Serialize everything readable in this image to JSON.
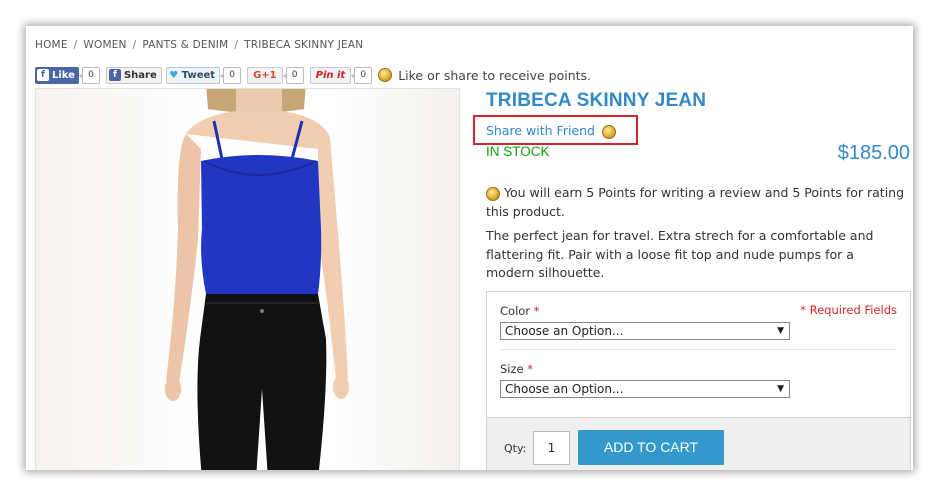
{
  "breadcrumb": {
    "items": [
      "HOME",
      "WOMEN",
      "PANTS & DENIM",
      "TRIBECA SKINNY JEAN"
    ],
    "separator": "/"
  },
  "social": {
    "fb_like": {
      "icon": "facebook-icon",
      "label": "Like",
      "count": "0"
    },
    "fb_share": {
      "icon": "facebook-icon",
      "label": "Share"
    },
    "tweet": {
      "icon": "twitter-bird-icon",
      "label": "Tweet",
      "count": "0"
    },
    "gplus": {
      "label": "G+1",
      "count": "0"
    },
    "pinit": {
      "label": "Pin it",
      "count": "0"
    },
    "reward_icon": "points-coin-icon",
    "reward_text": "Like or share to receive points."
  },
  "product": {
    "title": "TRIBECA SKINNY JEAN",
    "share_friend": "Share with Friend",
    "stock": "IN STOCK",
    "price": "$185.00",
    "points_note": "You will earn 5 Points for writing a review and 5 Points for rating this product.",
    "description": "The perfect jean for travel. Extra strech for a comfortable and flattering fit. Pair with a loose fit top and nude pumps for a modern silhouette."
  },
  "options": {
    "required_note": "* Required Fields",
    "color": {
      "label": "Color",
      "required_mark": "*",
      "selected": "Choose an Option..."
    },
    "size": {
      "label": "Size",
      "required_mark": "*",
      "selected": "Choose an Option..."
    }
  },
  "cart": {
    "qty_label": "Qty:",
    "qty_value": "1",
    "add_label": "ADD TO CART"
  },
  "colors": {
    "accent": "#3289c8",
    "in_stock": "#12a012",
    "highlight_box": "#d0262b",
    "add_to_cart": "#3399cc"
  }
}
